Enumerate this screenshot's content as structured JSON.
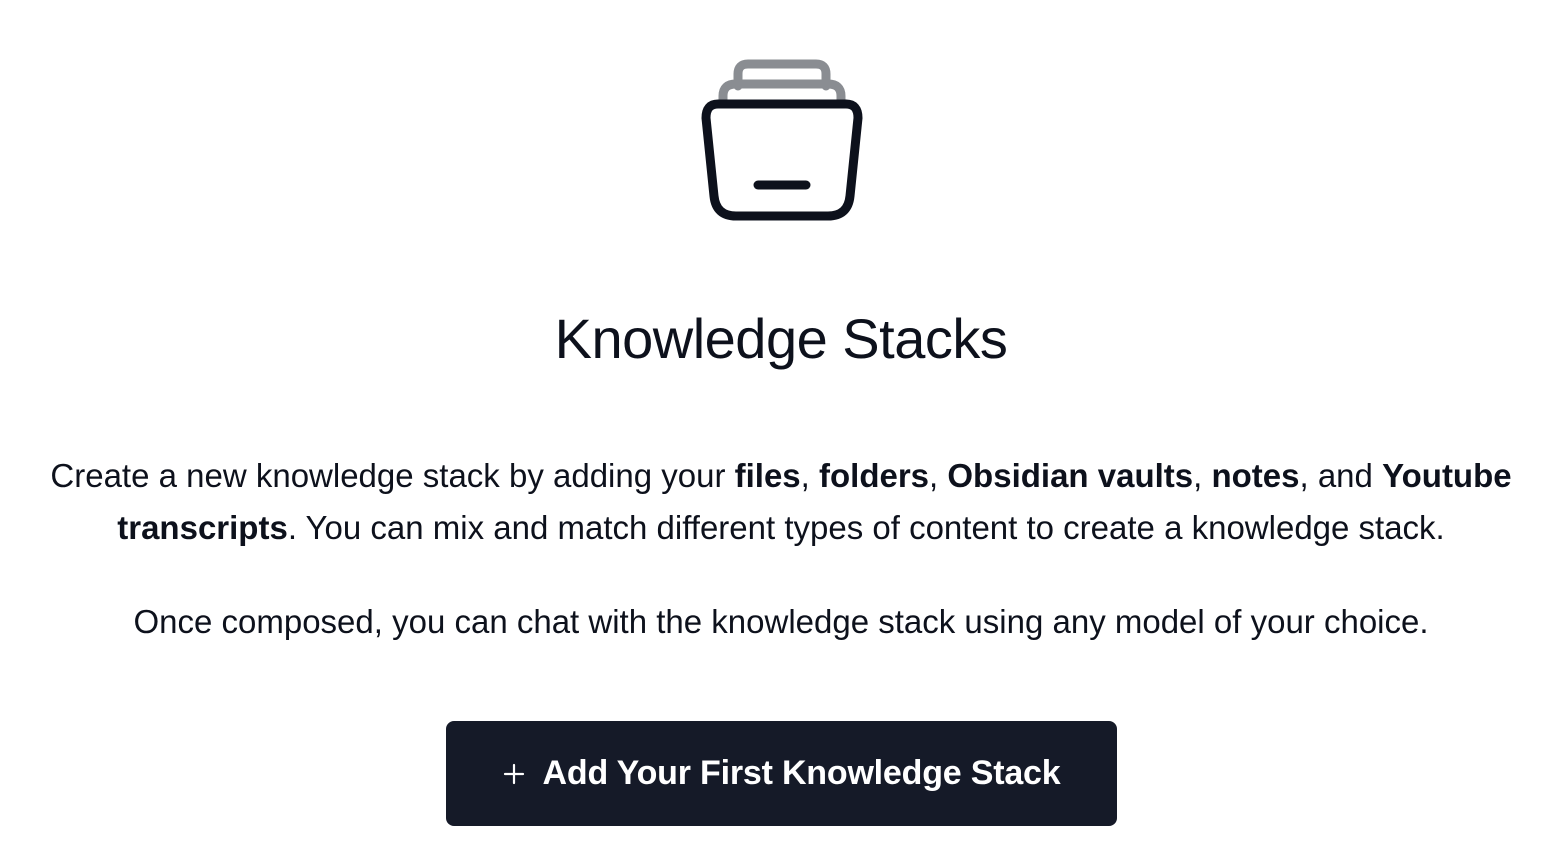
{
  "empty_state": {
    "icon": "stack-icon",
    "title": "Knowledge Stacks",
    "description": {
      "part1": "Create a new knowledge stack by adding your ",
      "files": "files",
      "sep1": ", ",
      "folders": "folders",
      "sep2": ", ",
      "obsidian": "Obsidian vaults",
      "sep3": ", ",
      "notes": "notes",
      "sep4": ", and ",
      "youtube": "Youtube transcripts",
      "part2": ". You can mix and match different types of content to create a knowledge stack."
    },
    "description2": "Once composed, you can chat with the knowledge stack using any model of your choice.",
    "add_button": {
      "icon": "plus-icon",
      "label": "Add Your First Knowledge Stack"
    }
  },
  "colors": {
    "button_bg": "#151a28",
    "text": "#0d111c",
    "icon_back": "#8a8d92",
    "icon_front": "#0d111c"
  }
}
